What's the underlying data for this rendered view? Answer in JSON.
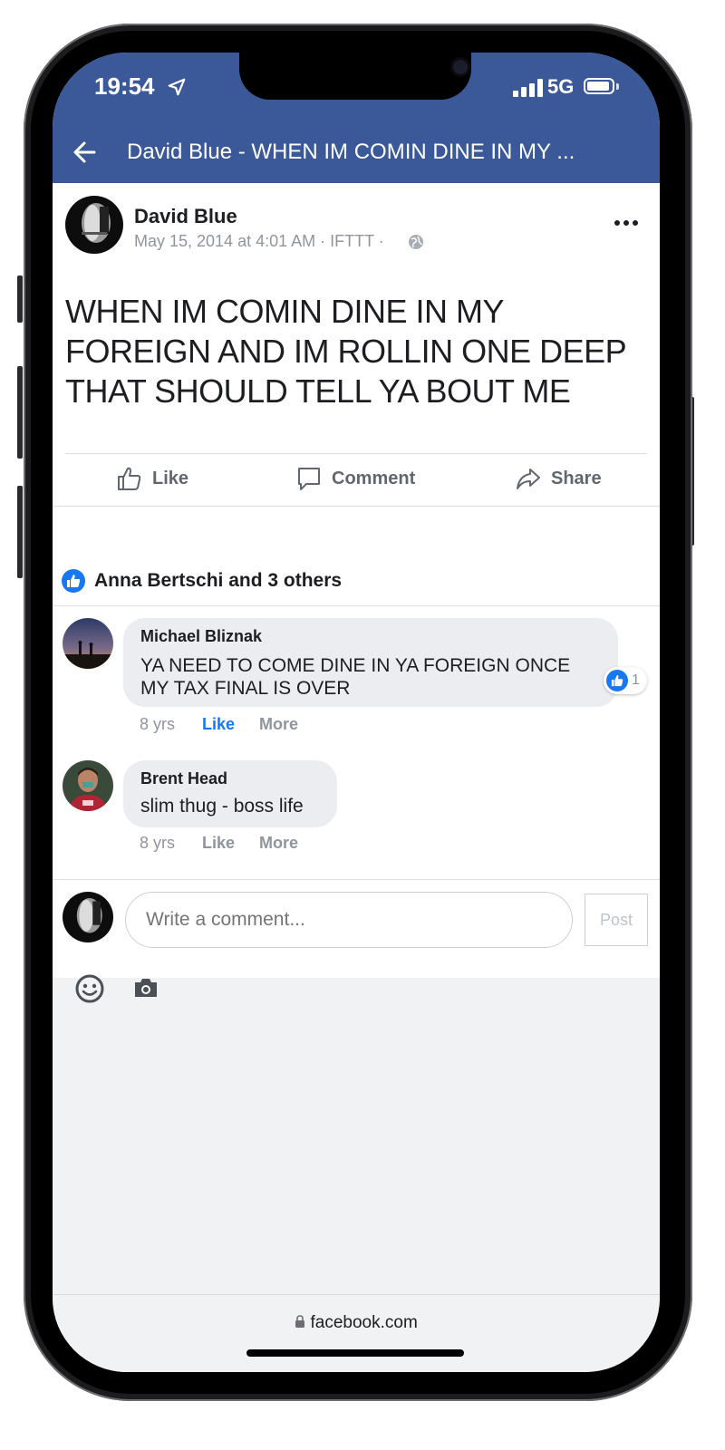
{
  "status_bar": {
    "time": "19:54",
    "network": "5G"
  },
  "header": {
    "title": "David Blue - WHEN IM COMIN DINE IN MY ..."
  },
  "post": {
    "author": "David Blue",
    "meta": "May 15, 2014 at 4:01 AM · IFTTT ·",
    "text": "WHEN IM COMIN DINE IN MY FOREIGN AND IM ROLLIN ONE DEEP THAT SHOULD TELL YA BOUT ME"
  },
  "actions": {
    "like": "Like",
    "comment": "Comment",
    "share": "Share"
  },
  "likes_summary": "Anna Bertschi and 3 others",
  "comments": [
    {
      "name": "Michael Bliznak",
      "text_line1": "YA NEED TO COME DINE IN YA FOREIGN ONCE",
      "text_line2": "MY TAX FINAL IS OVER",
      "time": "8 yrs",
      "like": "Like",
      "more": "More",
      "reactions": "1"
    },
    {
      "name": "Brent Head",
      "text": "slim thug - boss life",
      "time": "8 yrs",
      "like": "Like",
      "more": "More"
    }
  ],
  "composer": {
    "placeholder": "Write a comment...",
    "post_label": "Post"
  },
  "browser": {
    "url": "facebook.com"
  },
  "colors": {
    "brand": "#3b5998",
    "like_blue": "#1877f2"
  }
}
